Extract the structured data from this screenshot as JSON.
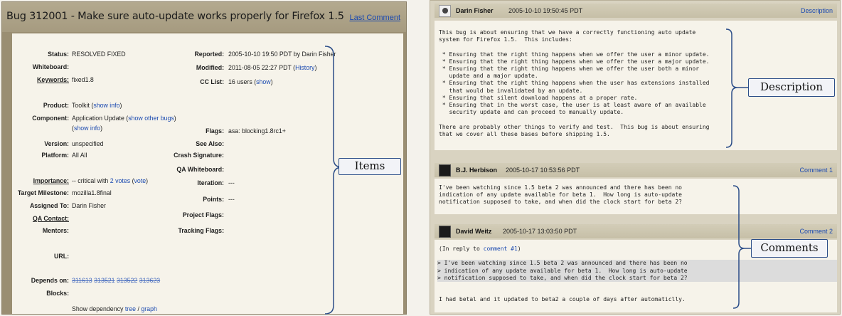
{
  "bug": {
    "title": "Bug 312001 - Make sure auto-update works properly for Firefox 1.5",
    "last_comment": "Last Comment"
  },
  "fields_left": [
    {
      "label": "Status:",
      "value": "RESOLVED FIXED"
    },
    {
      "label": "Whiteboard:",
      "value": ""
    },
    {
      "label": "Keywords:",
      "value": "fixed1.8"
    },
    {
      "label": "Product:",
      "value": "Toolkit",
      "link": "show info"
    },
    {
      "label": "Component:",
      "value": "Application Update",
      "link": "show other bugs",
      "link2": "show info"
    },
    {
      "label": "Version:",
      "value": "unspecified"
    },
    {
      "label": "Platform:",
      "value": "All All"
    },
    {
      "label": "Importance:",
      "value": "-- critical with",
      "link": "2 votes",
      "link2": "vote"
    },
    {
      "label": "Target Milestone:",
      "value": "mozilla1.8final"
    },
    {
      "label": "Assigned To:",
      "value": "Darin Fisher"
    },
    {
      "label": "QA Contact:",
      "value": ""
    },
    {
      "label": "Mentors:",
      "value": ""
    },
    {
      "label": "URL:",
      "value": ""
    },
    {
      "label": "Depends on:",
      "deps": [
        "311613",
        "313521",
        "313522",
        "313623"
      ]
    },
    {
      "label": "Blocks:",
      "value": ""
    }
  ],
  "dependency": {
    "prefix": "Show dependency",
    "tree": "tree",
    "sep": "/",
    "graph": "graph"
  },
  "fields_right": [
    {
      "label": "Reported:",
      "value": "2005-10-10 19:50 PDT by Darin Fisher"
    },
    {
      "label": "Modified:",
      "value": "2011-08-05 22:27 PDT",
      "link": "History"
    },
    {
      "label": "CC List:",
      "value": "16 users",
      "link": "show"
    },
    {
      "label": "Flags:",
      "value": "asa: blocking1.8rc1+"
    },
    {
      "label": "See Also:",
      "value": ""
    },
    {
      "label": "Crash Signature:",
      "value": ""
    },
    {
      "label": "QA Whiteboard:",
      "value": ""
    },
    {
      "label": "Iteration:",
      "value": "---"
    },
    {
      "label": "Points:",
      "value": "---"
    },
    {
      "label": "Project Flags:",
      "value": ""
    },
    {
      "label": "Tracking Flags:",
      "value": ""
    }
  ],
  "callouts": {
    "items": "Items",
    "description": "Description",
    "comments": "Comments"
  },
  "comments": [
    {
      "author": "Darin Fisher",
      "time": "2005-10-10 19:50:45 PDT",
      "tag": "Description",
      "lines": [
        "This bug is about ensuring that we have a correctly functioning auto update",
        "system for Firefox 1.5.  This includes:",
        "",
        " * Ensuring that the right thing happens when we offer the user a minor update.",
        " * Ensuring that the right thing happens when we offer the user a major update.",
        " * Ensuring that the right thing happens when we offer the user both a minor",
        "   update and a major update.",
        " * Ensuring that the right thing happens when the user has extensions installed",
        "   that would be invalidated by an update.",
        " * Ensuring that silent download happens at a proper rate.",
        " * Ensuring that in the worst case, the user is at least aware of an available",
        "   security update and can proceed to manually update.",
        "",
        "There are probably other things to verify and test.  This bug is about ensuring",
        "that we cover all these bases before shipping 1.5."
      ]
    },
    {
      "author": "B.J. Herbison",
      "time": "2005-10-17 10:53:56 PDT",
      "tag": "Comment 1",
      "lines": [
        "I've been watching since 1.5 beta 2 was announced and there has been no",
        "indication of any update available for beta 1.  How long is auto-update",
        "notification supposed to take, and when did the clock start for beta 2?"
      ]
    },
    {
      "author": "David Weitz",
      "time": "2005-10-17 13:03:50 PDT",
      "tag": "Comment 2",
      "reply_prefix": "(In reply to ",
      "reply_link": "comment #1",
      "reply_suffix": ")",
      "quote": [
        "> I've been watching since 1.5 beta 2 was announced and there has been no",
        "> indication of any update available for beta 1.  How long is auto-update",
        "> notification supposed to take, and when did the clock start for beta 2?"
      ],
      "after": "I had betal and it updated to beta2 a couple of days after automaticlly."
    }
  ]
}
